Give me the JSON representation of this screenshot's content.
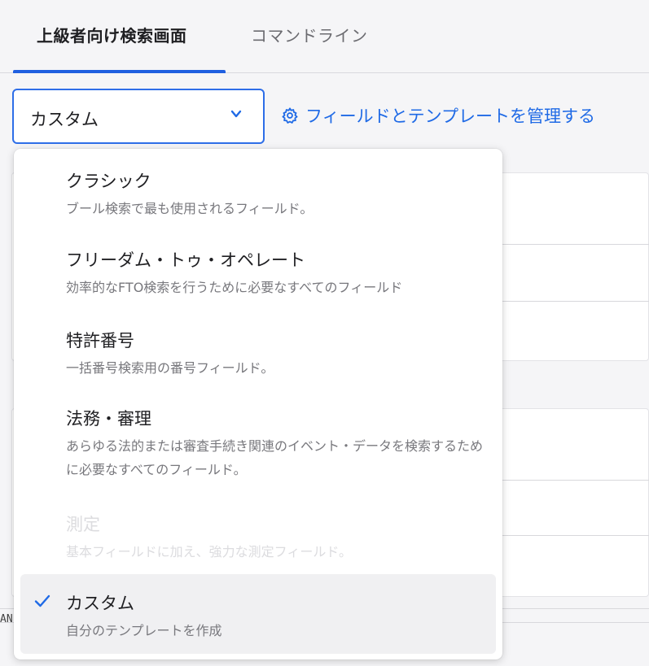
{
  "tabs": [
    {
      "label": "上級者向け検索画面",
      "active": true
    },
    {
      "label": "コマンドライン",
      "active": false
    }
  ],
  "template_select": {
    "value": "カスタム",
    "chevron_icon": "chevron-down-icon"
  },
  "manage_link": {
    "label": "フィールドとテンプレートを管理する",
    "icon": "gear-icon"
  },
  "side_text": "AN",
  "dropdown": {
    "options": [
      {
        "title": "クラシック",
        "description": "ブール検索で最も使用されるフィールド。",
        "state": "enabled"
      },
      {
        "title": "フリーダム・トゥ・オペレート",
        "description": "効率的なFTO検索を行うために必要なすべてのフィールド",
        "state": "enabled"
      },
      {
        "title": "特許番号",
        "description": "一括番号検索用の番号フィールド。",
        "state": "enabled"
      },
      {
        "title": "法務・審理",
        "description": "あらゆる法的または審査手続き関連のイベント・データを検索するために必要なすべてのフィールド。",
        "state": "enabled"
      },
      {
        "title": "測定",
        "description": "基本フィールドに加え、強力な測定フィールド。",
        "state": "disabled"
      },
      {
        "title": "カスタム",
        "description": "自分のテンプレートを作成",
        "state": "selected"
      }
    ]
  },
  "colors": {
    "accent": "#1f6ae6",
    "selected_bg": "#f0f0f2",
    "disabled_text": "#dcdcdf"
  }
}
